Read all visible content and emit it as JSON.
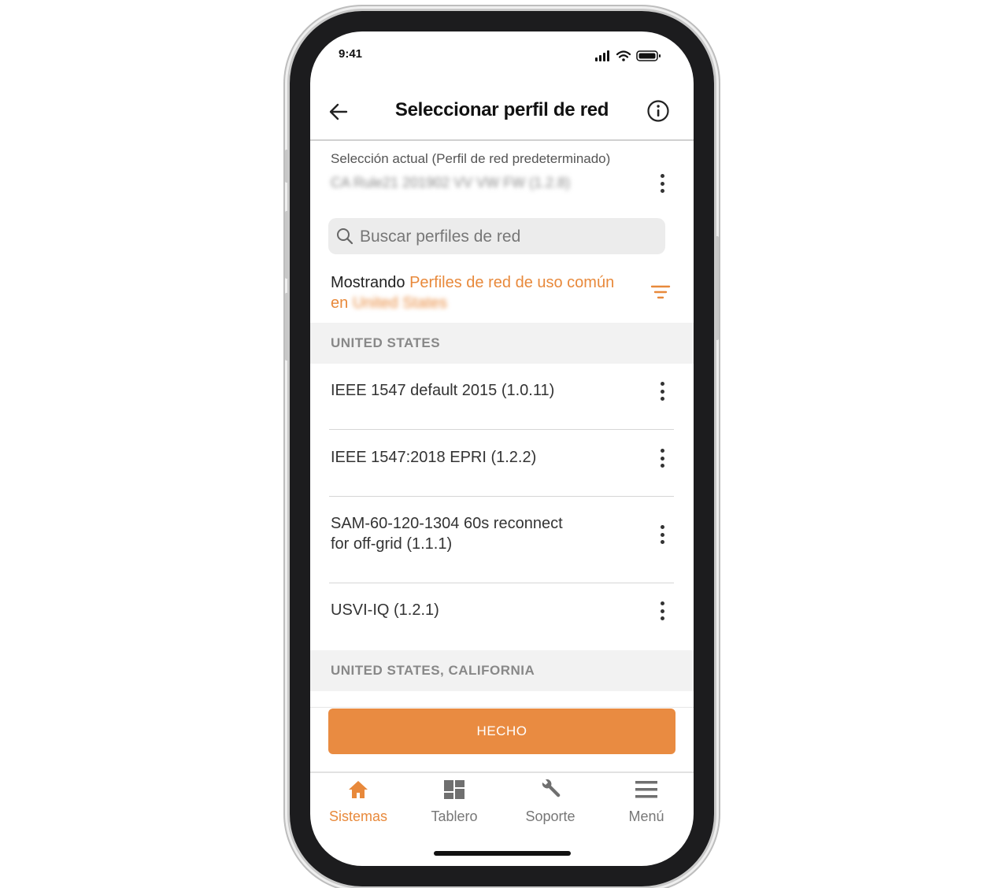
{
  "status_bar": {
    "time": "9:41"
  },
  "header": {
    "title": "Seleccionar perfil de red"
  },
  "current_selection": {
    "label": "Selección actual (Perfil de red predeterminado)",
    "value": "CA Rule21 201902 VV VW FW (1.2.8)"
  },
  "search": {
    "placeholder": "Buscar perfiles de red"
  },
  "filter_summary": {
    "prefix": "Mostrando",
    "filter": "Perfiles de red de uso común",
    "connector": "en",
    "region": "United States"
  },
  "sections": [
    {
      "title": "UNITED STATES",
      "items": [
        {
          "label": "IEEE 1547 default 2015 (1.0.11)"
        },
        {
          "label": "IEEE 1547:2018 EPRI (1.2.2)"
        },
        {
          "label": "SAM-60-120-1304 60s reconnect\nfor off-grid (1.1.1)"
        },
        {
          "label": "USVI-IQ (1.2.1)"
        }
      ]
    },
    {
      "title": "UNITED STATES, CALIFORNIA",
      "items": []
    }
  ],
  "done_button": {
    "label": "HECHO"
  },
  "tab_bar": {
    "items": [
      {
        "label": "Sistemas",
        "icon": "home-icon",
        "active": true
      },
      {
        "label": "Tablero",
        "icon": "dashboard-icon",
        "active": false
      },
      {
        "label": "Soporte",
        "icon": "wrench-icon",
        "active": false
      },
      {
        "label": "Menú",
        "icon": "menu-icon",
        "active": false
      }
    ]
  },
  "colors": {
    "accent": "#e8893b",
    "button": "#e98b41",
    "section_bg": "#f2f2f2"
  }
}
